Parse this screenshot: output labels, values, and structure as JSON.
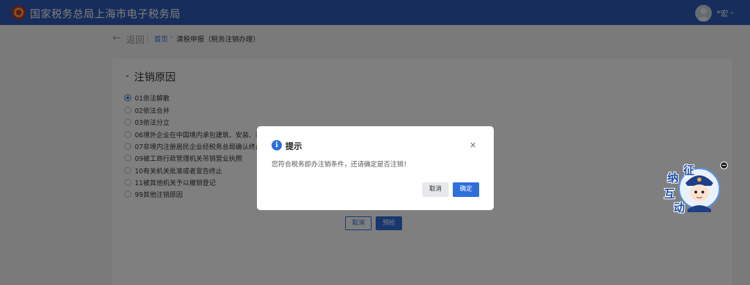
{
  "header": {
    "site_title": "国家税务总局上海市电子税务局",
    "user_name": "*宏",
    "user_caret": "⌄"
  },
  "breadcrumb": {
    "back_label": "返回",
    "home": "首页",
    "separator": "›",
    "current": "清税申报（税务注销办理）"
  },
  "section": {
    "title": "注销原因",
    "reasons": [
      {
        "label": "01依法解散",
        "checked": true
      },
      {
        "label": "02依法合并",
        "checked": false
      },
      {
        "label": "03依法分立",
        "checked": false
      },
      {
        "label": "06境外企业在中国境内承包建筑、安装、装配",
        "checked": false
      },
      {
        "label": "07非境内注册居民企业经税务总局确认终止居",
        "checked": false
      },
      {
        "label": "09被工商行政管理机关吊销营业执照",
        "checked": false
      },
      {
        "label": "10有关机关批准或者宣告终止",
        "checked": false
      },
      {
        "label": "11被其他机关予以撤销登记",
        "checked": false
      },
      {
        "label": "99其他注销原因",
        "checked": false
      }
    ]
  },
  "form_actions": {
    "cancel_label": "取消",
    "check_label": "预检"
  },
  "dialog": {
    "icon": "info-icon",
    "title": "提示",
    "close": "×",
    "message": "您符合税务即办注销条件，还请确定是否注销！",
    "cancel_label": "取消",
    "ok_label": "确定"
  },
  "widget": {
    "chars": [
      "征",
      "纳",
      "互",
      "动"
    ]
  },
  "colors": {
    "header_bg": "#2f5bb7",
    "accent": "#2f6fdc",
    "overlay": "rgba(0,0,0,0.5)"
  }
}
